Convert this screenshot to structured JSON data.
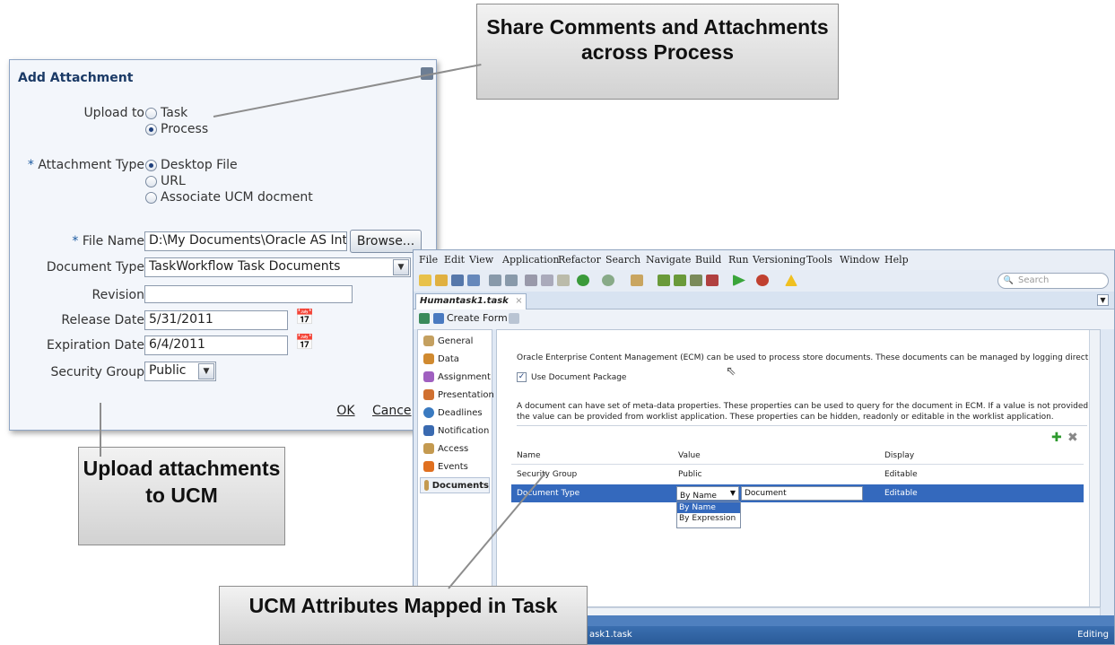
{
  "dialog": {
    "title": "Add Attachment",
    "upload_to": {
      "label": "Upload to",
      "options": [
        "Task",
        "Process"
      ],
      "selected": "Process"
    },
    "attachment_type": {
      "required_mark": "*",
      "label": "Attachment Type",
      "options": [
        "Desktop File",
        "URL",
        "Associate UCM docment"
      ],
      "selected": "Desktop File"
    },
    "file_name": {
      "required_mark": "*",
      "label": "File Name",
      "value": "D:\\My Documents\\Oracle AS Integ",
      "browse_label": "Browse..."
    },
    "document_type": {
      "label": "Document Type",
      "value": "TaskWorkflow Task Documents"
    },
    "revision": {
      "label": "Revision",
      "value": ""
    },
    "release_date": {
      "label": "Release Date",
      "value": "5/31/2011"
    },
    "expiration_date": {
      "label": "Expiration Date",
      "value": "6/4/2011"
    },
    "security_group": {
      "label": "Security Group",
      "value": "Public"
    },
    "ok_label": "OK",
    "cancel_label": "Cance"
  },
  "callouts": {
    "share": "Share Comments and Attachments across Process",
    "upload": "Upload attachments to UCM",
    "mapped": "UCM Attributes Mapped in Task"
  },
  "ide": {
    "menu": [
      "File",
      "Edit",
      "View",
      "Application",
      "Refactor",
      "Search",
      "Navigate",
      "Build",
      "Run",
      "Versioning",
      "Tools",
      "Window",
      "Help"
    ],
    "search_placeholder": "Search",
    "doc_tab": "Humantask1.task",
    "create_form": "Create Form",
    "nav": [
      "General",
      "Data",
      "Assignment",
      "Presentation",
      "Deadlines",
      "Notification",
      "Access",
      "Events",
      "Documents"
    ],
    "nav_selected": "Documents",
    "intro": "Oracle Enterprise Content Management (ECM) can be used to process store documents. These documents can be managed by logging directly to ECM",
    "use_package": "Use Document Package",
    "meta_line1": "A document can have set of meta-data properties. These properties can be used to query for the document in ECM. If a value is not provided for the property,",
    "meta_line2": "the value can be provided from worklist application. These properties can be hidden, readonly or editable in the worklist application.",
    "columns": [
      "Name",
      "Value",
      "Display"
    ],
    "rows": [
      {
        "name": "Security Group",
        "value": "Public",
        "display": "Editable"
      },
      {
        "name": "Document Type",
        "value_mode": "By Name",
        "value": "Document",
        "display": "Editable"
      }
    ],
    "value_mode_options": [
      "By Name",
      "By Expression"
    ],
    "status_file": "ask1.task",
    "status_mode": "Editing"
  }
}
